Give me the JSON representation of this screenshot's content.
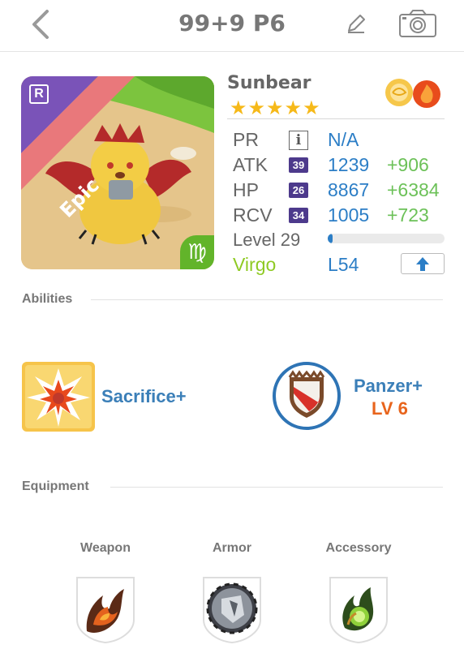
{
  "header": {
    "title": "99+9 P6"
  },
  "monster": {
    "name": "Sunbear",
    "rarity": "Epic",
    "rarity_badge": "R",
    "zodiac_symbol": "♍",
    "stars": "★★★★★",
    "star_count": 5,
    "elements": [
      "light-cloud-icon",
      "fire-icon"
    ]
  },
  "stats": {
    "pr": {
      "label": "PR",
      "info": "i",
      "value": "N/A"
    },
    "atk": {
      "label": "ATK",
      "level": "39",
      "value": "1239",
      "plus": "+906"
    },
    "hp": {
      "label": "HP",
      "level": "26",
      "value": "8867",
      "plus": "+6384"
    },
    "rcv": {
      "label": "RCV",
      "level": "34",
      "value": "1005",
      "plus": "+723"
    },
    "level": {
      "label": "Level 29",
      "progress": 0.04
    },
    "zodiac": {
      "name": "Virgo",
      "level": "L54"
    }
  },
  "abilities": {
    "section_title": "Abilities",
    "items": [
      {
        "name": "Sacrifice+",
        "icon": "explosion-icon"
      },
      {
        "name": "Panzer+",
        "level": "LV 6",
        "icon": "shield-icon"
      }
    ]
  },
  "equipment": {
    "section_title": "Equipment",
    "slots": [
      {
        "label": "Weapon",
        "icon": "fire-claw-icon"
      },
      {
        "label": "Armor",
        "icon": "dark-shield-icon"
      },
      {
        "label": "Accessory",
        "icon": "green-orb-icon"
      }
    ]
  },
  "colors": {
    "accent_blue": "#2c7ec6",
    "bonus_green": "#6cc158",
    "zodiac_green": "#8fca24",
    "ability_level_orange": "#e8641c",
    "star_gold": "#f6b919",
    "epic_banner": "#e9787b",
    "stat_badge_purple": "#4d3a8c"
  }
}
